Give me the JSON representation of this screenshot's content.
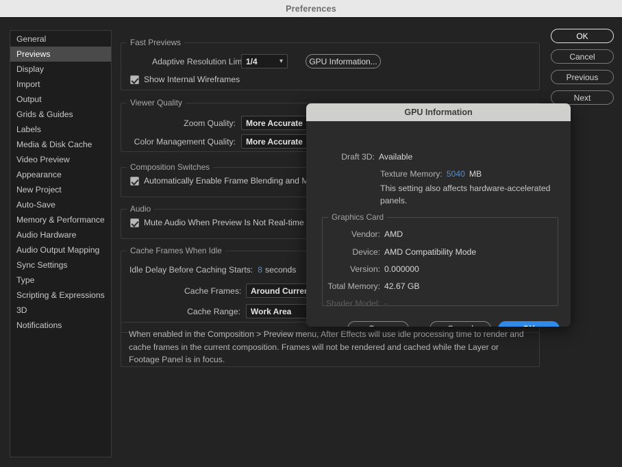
{
  "window": {
    "title": "Preferences"
  },
  "colors": {
    "accent": "#2f8ae8",
    "scrub_value": "#4d8fd6",
    "selected_row": "#4a4a4a",
    "panel_bg": "#232323",
    "titlebar_bg": "#e8e8e8"
  },
  "sidebar": {
    "items": [
      {
        "label": "General"
      },
      {
        "label": "Previews"
      },
      {
        "label": "Display"
      },
      {
        "label": "Import"
      },
      {
        "label": "Output"
      },
      {
        "label": "Grids & Guides"
      },
      {
        "label": "Labels"
      },
      {
        "label": "Media & Disk Cache"
      },
      {
        "label": "Video Preview"
      },
      {
        "label": "Appearance"
      },
      {
        "label": "New Project"
      },
      {
        "label": "Auto-Save"
      },
      {
        "label": "Memory & Performance"
      },
      {
        "label": "Audio Hardware"
      },
      {
        "label": "Audio Output Mapping"
      },
      {
        "label": "Sync Settings"
      },
      {
        "label": "Type"
      },
      {
        "label": "Scripting & Expressions"
      },
      {
        "label": "3D"
      },
      {
        "label": "Notifications"
      }
    ],
    "selected_index": 1
  },
  "main": {
    "fast_previews": {
      "title": "Fast Previews",
      "adaptive_resolution_label": "Adaptive Resolution Limit:",
      "adaptive_resolution_value": "1/4",
      "gpu_information_button": "GPU Information...",
      "show_internal_wireframes_label": "Show Internal Wireframes",
      "show_internal_wireframes_checked": true
    },
    "viewer_quality": {
      "title": "Viewer Quality",
      "zoom_quality_label": "Zoom Quality:",
      "zoom_quality_value": "More Accurate",
      "color_management_label": "Color Management Quality:",
      "color_management_value": "More Accurate"
    },
    "composition_switches": {
      "title": "Composition Switches",
      "auto_frame_blending_label": "Automatically Enable Frame Blending and Motion",
      "auto_frame_blending_checked": true
    },
    "audio": {
      "title": "Audio",
      "mute_audio_label": "Mute Audio When Preview Is Not Real-time",
      "mute_audio_checked": true
    },
    "cache_frames": {
      "title": "Cache Frames When Idle",
      "idle_delay_label": "Idle Delay Before Caching Starts:",
      "idle_delay_value": "8",
      "idle_delay_unit": "seconds",
      "cache_frames_label": "Cache Frames:",
      "cache_frames_value": "Around Current T",
      "cache_range_label": "Cache Range:",
      "cache_range_value": "Work Area"
    },
    "description": "When enabled in the Composition > Preview menu, After Effects will use idle processing time to render and cache frames in the current composition. Frames will not be rendered and cached while the Layer or Footage Panel is in focus."
  },
  "side_buttons": {
    "ok": "OK",
    "cancel": "Cancel",
    "previous": "Previous",
    "next": "Next"
  },
  "gpu_dialog": {
    "title": "GPU Information",
    "draft3d_label": "Draft 3D:",
    "draft3d_value": "Available",
    "texture_memory_label": "Texture Memory:",
    "texture_memory_value": "5040",
    "texture_memory_unit": "MB",
    "texture_memory_note": "This setting also affects hardware-accelerated panels.",
    "graphics_card_title": "Graphics Card",
    "vendor_label": "Vendor:",
    "vendor_value": "AMD",
    "device_label": "Device:",
    "device_value": "AMD Compatibility Mode",
    "version_label": "Version:",
    "version_value": "0.000000",
    "total_memory_label": "Total Memory:",
    "total_memory_value": "42.67 GB",
    "shader_model_label": "Shader Model:",
    "shader_model_value": "-",
    "copy_button": "Copy",
    "cancel_button": "Cancel",
    "ok_button": "OK"
  }
}
